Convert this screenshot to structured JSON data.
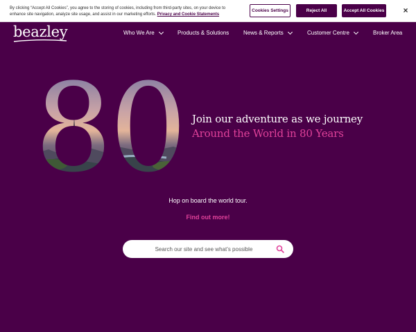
{
  "cookie": {
    "text": "By clicking “Accept All Cookies”, you agree to the storing of cookies, including from third-party sites, on your device to enhance site navigation, analyze site usage, and assist in our marketing efforts.",
    "link": "Privacy and Cookie Statements",
    "settings_label": "Cookies Settings",
    "reject_label": "Reject All",
    "accept_label": "Accept All Cookies",
    "close_glyph": "×"
  },
  "header": {
    "logo": "beazley",
    "nav": [
      {
        "label": "Who We Are",
        "has_dropdown": true
      },
      {
        "label": "Products & Solutions",
        "has_dropdown": false
      },
      {
        "label": "News & Reports",
        "has_dropdown": true
      },
      {
        "label": "Customer Centre",
        "has_dropdown": true
      },
      {
        "label": "Broker Area",
        "has_dropdown": false
      }
    ]
  },
  "hero": {
    "number": "80",
    "title": "Join our adventure as we journey",
    "subtitle": "Around the World in 80 Years",
    "tagline": "Hop on board the world tour.",
    "cta": "Find out more!"
  },
  "search": {
    "placeholder": "Search our site and see what’s possible"
  },
  "colors": {
    "brand_purple": "#4a0048",
    "accent_pink": "#e0419a",
    "white": "#ffffff"
  },
  "icons": [
    "close-icon",
    "chevron-down-icon",
    "search-icon"
  ]
}
